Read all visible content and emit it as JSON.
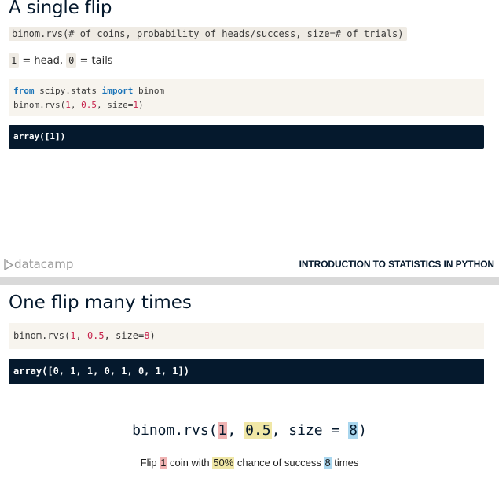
{
  "slide1": {
    "title": "A single flip",
    "signature": "binom.rvs(# of coins, probability of heads/success, size=# of trials)",
    "legend": {
      "one": "1",
      "head_text": " = head, ",
      "zero": "0",
      "tails_text": " = tails"
    },
    "code": {
      "from": "from",
      "module": " scipy.stats ",
      "import": "import",
      "name": " binom",
      "call_open": "binom.rvs(",
      "arg1": "1",
      "sep1": ", ",
      "arg2": "0.5",
      "sep2": ", size=",
      "arg3": "1",
      "close": ")"
    },
    "output": "array([1])"
  },
  "footer": {
    "brand": "datacamp",
    "course": "INTRODUCTION TO STATISTICS IN PYTHON"
  },
  "slide2": {
    "title": "One flip many times",
    "code": {
      "call_open": "binom.rvs(",
      "arg1": "1",
      "sep1": ", ",
      "arg2": "0.5",
      "sep2": ", size=",
      "arg3": "8",
      "close": ")"
    },
    "output": "array([0, 1, 1, 0, 1, 0, 1, 1])",
    "formula": {
      "open": "binom.rvs(",
      "arg1": "1",
      "sep1": ", ",
      "arg2": "0.5",
      "sep2": ", size = ",
      "arg3": "8",
      "close": ")"
    },
    "caption": {
      "t1": "Flip ",
      "n": "1",
      "t2": " coin with ",
      "p": "50%",
      "t3": " chance of success ",
      "k": "8",
      "t4": " times"
    }
  },
  "colors": {
    "code_output_bg": "#05192d",
    "highlight_red": "#f0b3b3",
    "highlight_yellow": "#f0e7a6",
    "highlight_blue": "#a9d6ee"
  }
}
